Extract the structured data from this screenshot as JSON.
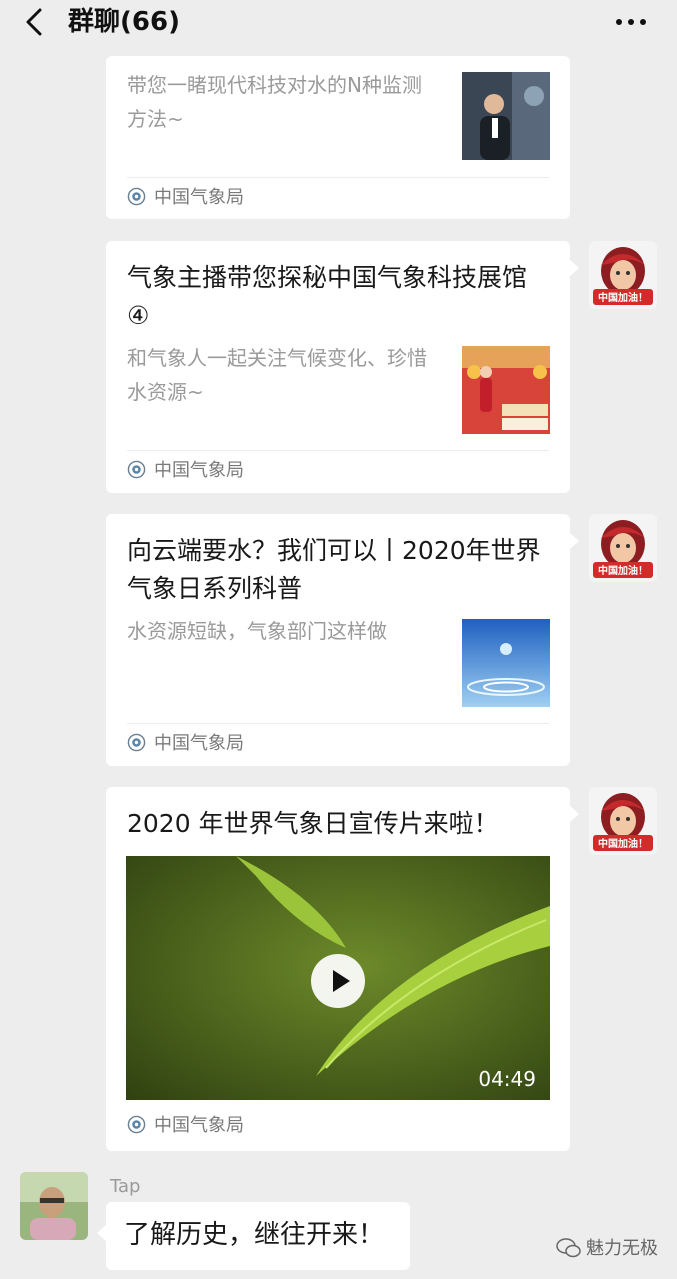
{
  "header": {
    "title": "群聊(66)"
  },
  "cards": [
    {
      "title": "",
      "desc": "带您一睹现代科技对水的N种监测方法~",
      "source": "中国气象局"
    },
    {
      "title": "气象主播带您探秘中国气象科技展馆④",
      "desc": "和气象人一起关注气候变化、珍惜水资源~",
      "source": "中国气象局"
    },
    {
      "title": "向云端要水？我们可以丨2020年世界气象日系列科普",
      "desc": "水资源短缺，气象部门这样做",
      "source": "中国气象局"
    },
    {
      "title": "2020 年世界气象日宣传片来啦！",
      "duration": "04:49",
      "source": "中国气象局"
    }
  ],
  "avatar_badge": "中国加油！",
  "message": {
    "sender": "Tap",
    "text": "了解历史，继往开来！"
  },
  "watermark": "魅力无极",
  "colors": {
    "background": "#ededed",
    "card": "#ffffff",
    "secondary_text": "#9a9a9a"
  }
}
